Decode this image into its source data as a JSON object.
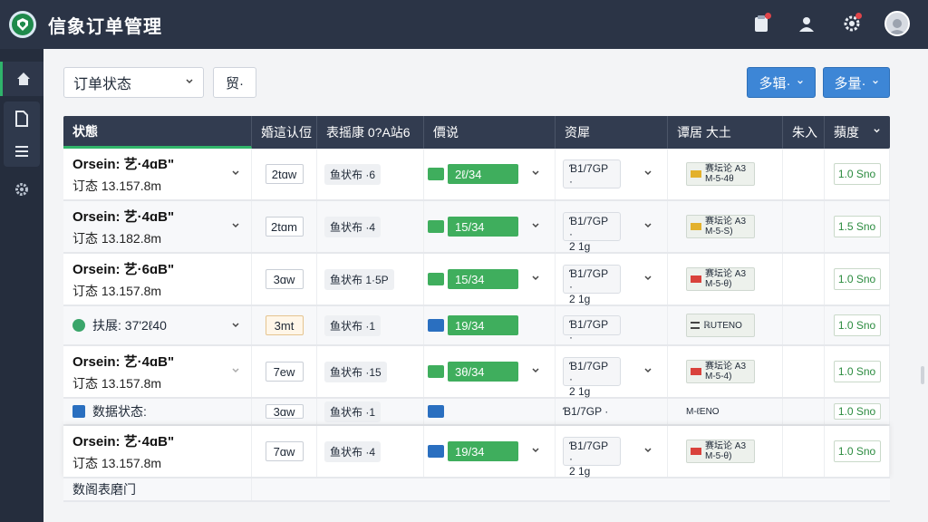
{
  "app": {
    "title": "信象订单管理"
  },
  "toolbar": {
    "status_filter_label": "订单状态",
    "small_select_label": "贸·",
    "button_1_label": "多辑·",
    "button_2_label": "多量·"
  },
  "columns": [
    "状態",
    "婚這认侸",
    "表摇康 0?A站6",
    "價说",
    "资犀",
    "谭居 大土",
    "朱入",
    "蘋度"
  ],
  "rows": [
    {
      "line1": "Orsein: 艺·4ɑB\"",
      "line2": "订态 13.157.8m",
      "qty": "2tɑw",
      "field": "鱼状布 ·6",
      "tag": "2ℓ/34",
      "box_a": "Ɓ1/7GP ·",
      "box_b": "",
      "code_a": "赛坛论 A3",
      "code_b": "M-5-4θ",
      "amount": "1.0 Sno"
    },
    {
      "line1": "Orsein: 艺·4ɑB\"",
      "line2": "订态 13.182.8m",
      "qty": "2tɑm",
      "field": "鱼状布 ·4",
      "tag": "15/34",
      "box_a": "Ɓ1/7GP ·",
      "box_b": "2 1g",
      "code_a": "赛坛论 A3",
      "code_b": "M-5-S)",
      "amount": "1.5 Sno"
    },
    {
      "line1": "Orsein: 艺·6ɑB\"",
      "line2": "订态 13.157.8m",
      "qty": "3ɑw",
      "field": "鱼状布 1·5P",
      "tag": "15/34",
      "box_a": "Ɓ1/7GP ·",
      "box_b": "2 1g",
      "code_a": "赛坛论 A3",
      "code_b": "M-5-θ)",
      "amount": "1.0 Sno"
    },
    {
      "line1": "扶展: 37'2ℓ40",
      "line2": "",
      "qty": "3mt",
      "field": "鱼状布 ·1",
      "tag": "19/34",
      "box_a": "Ɓ1/7GP ·",
      "box_b": "",
      "code_a": "ℝUTENO",
      "code_b": "",
      "amount": "1.0 Sno"
    },
    {
      "line1": "Orsein: 艺·4ɑB\"",
      "line2": "订态 13.157.8m",
      "qty": "7ew",
      "field": "鱼状布 ·15",
      "tag": "3θ/34",
      "box_a": "Ɓ1/7GP ·",
      "box_b": "2 1g",
      "code_a": "赛坛论 A3",
      "code_b": "M-5-4)",
      "amount": "1.0 Sno"
    },
    {
      "line1": "数据状态:",
      "line2": "",
      "qty": "3ɑw",
      "field": "鱼状布 ·1",
      "tag": "",
      "box_a": "Ɓ1/7GP ·",
      "box_b": "",
      "code_a": "M-ℓENO",
      "code_b": "",
      "amount": "1.0 Sno"
    },
    {
      "line1": "Orsein: 艺·4ɑB\"",
      "line2": "订态 13.157.8m",
      "qty": "7ɑw",
      "field": "鱼状布 ·4",
      "tag": "19/34",
      "box_a": "Ɓ1/7GP ·",
      "box_b": "2 1g",
      "code_a": "赛坛论 A3",
      "code_b": "M-5-θ)",
      "amount": "1.0 Sno"
    },
    {
      "line1": "数阁表磨门",
      "line2": "",
      "qty": "",
      "field": "",
      "tag": "",
      "box_a": "",
      "box_b": "",
      "code_a": "",
      "code_b": "",
      "amount": ""
    }
  ]
}
